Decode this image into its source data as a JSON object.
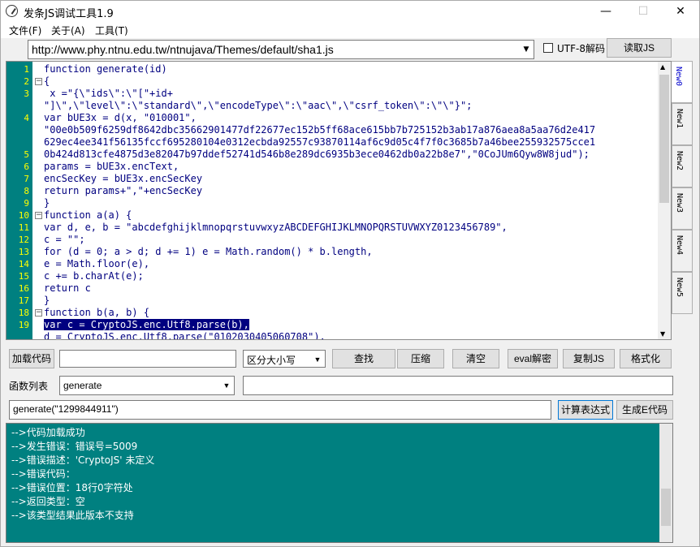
{
  "window": {
    "title": "发条JS调试工具1.9",
    "minimize": "—",
    "maximize": "☐",
    "close": "✕"
  },
  "menu": [
    "文件(F)",
    "关于(A)",
    "工具(T)"
  ],
  "url": {
    "value": "http://www.phy.ntnu.edu.tw/ntnujava/Themes/default/sha1.js"
  },
  "utf8_label": "UTF-8解码",
  "read_js_button": "读取JS",
  "line_numbers": [
    "1",
    "2",
    "3",
    "",
    "4",
    "",
    "",
    "5",
    "6",
    "7",
    "8",
    "9",
    "10",
    "11",
    "12",
    "13",
    "14",
    "15",
    "16",
    "17",
    "18",
    "19"
  ],
  "code_lines": [
    "function generate(id)",
    "{",
    " x =\"{\\\"ids\\\":\\\"[\"+id+",
    "\"]\\\",\\\"level\\\":\\\"standard\\\",\\\"encodeType\\\":\\\"aac\\\",\\\"csrf_token\\\":\\\"\\\"}\";",
    "var bUE3x = d(x, \"010001\",",
    "\"00e0b509f6259df8642dbc35662901477df22677ec152b5ff68ace615bb7b725152b3ab17a876aea8a5aa76d2e417",
    "629ec4ee341f56135fccf695280104e0312ecbda92557c93870114af6c9d05c4f7f0c3685b7a46bee255932575cce1",
    "0b424d813cfe4875d3e82047b97ddef52741d546b8e289dc6935b3ece0462db0a22b8e7\",\"0CoJUm6Qyw8W8jud\");",
    "params = bUE3x.encText,",
    "encSecKey = bUE3x.encSecKey",
    "return params+\",\"+encSecKey",
    "}",
    "function a(a) {",
    "var d, e, b = \"abcdefghijklmnopqrstuvwxyzABCDEFGHIJKLMNOPQRSTUVWXYZ0123456789\",",
    "c = \"\";",
    "for (d = 0; a > d; d += 1) e = Math.random() * b.length,",
    "e = Math.floor(e),",
    "c += b.charAt(e);",
    "return c",
    "}",
    "function b(a, b) {",
    "var c = CryptoJS.enc.Utf8.parse(b),",
    "d = CryptoJS.enc.Utf8.parse(\"0102030405060708\"),"
  ],
  "tabs": [
    "New0",
    "New1",
    "New2",
    "New3",
    "New4",
    "New5"
  ],
  "toolbar": {
    "load_code": "加载代码",
    "load_input": "",
    "case_option": "区分大小写",
    "find": "查找",
    "compress": "压缩",
    "clear": "清空",
    "eval_decode": "eval解密",
    "copy_js": "复制JS",
    "format": "格式化"
  },
  "func_list": {
    "label": "函数列表",
    "selected": "generate",
    "extra": ""
  },
  "expression": {
    "value": "generate(\"1299844911\")",
    "calc_button": "计算表达式",
    "gen_button": "生成E代码"
  },
  "output_lines": [
    "-->代码加载成功",
    "-->发生错误：错误号=5009",
    "-->错误描述：'CryptoJS' 未定义",
    "-->错误代码：",
    "-->错误位置：18行0字符处",
    "-->返回类型：空",
    "-->该类型结果此版本不支持"
  ],
  "colors": {
    "gutter": "#008080",
    "output_bg": "#008080",
    "selection": "#000080"
  }
}
